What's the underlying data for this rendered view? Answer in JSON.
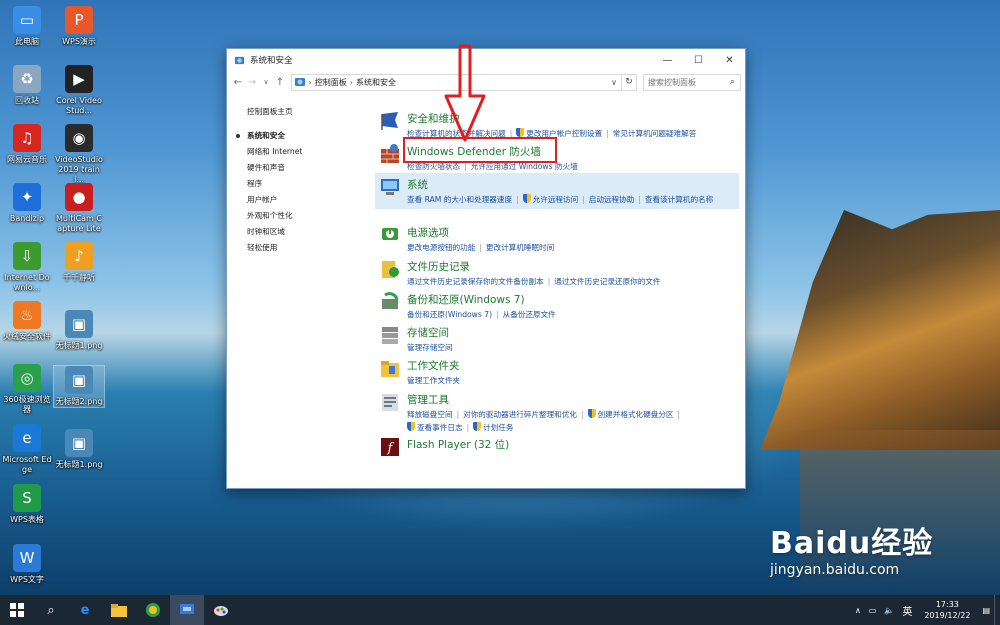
{
  "desktop": {
    "icons": [
      {
        "label": "此电脑",
        "icon": "this-pc-icon",
        "color": "#3a8ee6"
      },
      {
        "label": "WPS演示",
        "icon": "wps-presentation-icon",
        "color": "#e8572a"
      },
      {
        "label": "回收站",
        "icon": "recycle-bin-icon",
        "color": "#8aa6c0"
      },
      {
        "label": "Corel VideoStud...",
        "icon": "corel-videostudio-icon",
        "color": "#222222"
      },
      {
        "label": "网易云音乐",
        "icon": "netease-music-icon",
        "color": "#d8261f"
      },
      {
        "label": "VideoStudio 2019 traini...",
        "icon": "videostudio-training-icon",
        "color": "#2b2b2b"
      },
      {
        "label": "Bandizip",
        "icon": "bandizip-icon",
        "color": "#1e6fd9"
      },
      {
        "label": "MultiCam Capture Lite",
        "icon": "multicam-icon",
        "color": "#c81e1e"
      },
      {
        "label": "Internet Downlo...",
        "icon": "internet-download-icon",
        "color": "#3c9a2e"
      },
      {
        "label": "千千静听",
        "icon": "ttplayer-icon",
        "color": "#f0a020"
      },
      {
        "label": "火绒安全软件",
        "icon": "huorong-icon",
        "color": "#f07820"
      },
      {
        "label": "无标题1.png",
        "icon": "image-file-icon",
        "color": "#4a88b8"
      },
      {
        "label": "360极速浏览器",
        "icon": "360-browser-icon",
        "color": "#2aa04a"
      },
      {
        "label": "无标题2.png",
        "icon": "image-file-icon",
        "color": "#4a88b8"
      },
      {
        "label": "Microsoft Edge",
        "icon": "edge-icon",
        "color": "#1a78d6"
      },
      {
        "label": "无标题1.png",
        "icon": "image-file-icon",
        "color": "#4a88b8"
      },
      {
        "label": "WPS表格",
        "icon": "wps-spreadsheet-icon",
        "color": "#1f9a48"
      },
      {
        "label": "WPS文字",
        "icon": "wps-writer-icon",
        "color": "#2b7ad8"
      }
    ]
  },
  "window": {
    "title": "系统和安全",
    "controls": {
      "minimize": "—",
      "maximize": "☐",
      "close": "✕"
    },
    "address": {
      "root": "控制面板",
      "current": "系统和安全"
    },
    "search_placeholder": "搜索控制面板",
    "leftnav": {
      "home": "控制面板主页",
      "items": [
        "系统和安全",
        "网络和 Internet",
        "硬件和声音",
        "程序",
        "用户帐户",
        "外观和个性化",
        "时钟和区域",
        "轻松使用"
      ]
    },
    "categories": [
      {
        "title": "安全和维护",
        "icon": "security-maintenance-icon",
        "links": [
          [
            "检查计算机的状态并解决问题",
            false
          ],
          [
            "更改用户帐户控制设置",
            true
          ],
          [
            "常见计算机问题疑难解答",
            false
          ]
        ]
      },
      {
        "title": "Windows Defender 防火墙",
        "icon": "firewall-icon",
        "links": [
          [
            "检查防火墙状态",
            false
          ],
          [
            "允许应用通过 Windows 防火墙",
            false
          ]
        ]
      },
      {
        "title": "系统",
        "icon": "system-icon",
        "links": [
          [
            "查看 RAM 的大小和处理器速度",
            false
          ],
          [
            "允许远程访问",
            true
          ],
          [
            "启动远程协助",
            false
          ],
          [
            "查看该计算机的名称",
            false
          ]
        ]
      },
      {
        "title": "电源选项",
        "icon": "power-options-icon",
        "links": [
          [
            "更改电源按钮的功能",
            false
          ],
          [
            "更改计算机睡眠时间",
            false
          ]
        ]
      },
      {
        "title": "文件历史记录",
        "icon": "file-history-icon",
        "links": [
          [
            "通过文件历史记录保存你的文件备份副本",
            false
          ],
          [
            "通过文件历史记录还原你的文件",
            false
          ]
        ]
      },
      {
        "title": "备份和还原(Windows 7)",
        "icon": "backup-restore-icon",
        "links": [
          [
            "备份和还原(Windows 7)",
            false
          ],
          [
            "从备份还原文件",
            false
          ]
        ]
      },
      {
        "title": "存储空间",
        "icon": "storage-spaces-icon",
        "links": [
          [
            "管理存储空间",
            false
          ]
        ]
      },
      {
        "title": "工作文件夹",
        "icon": "work-folders-icon",
        "links": [
          [
            "管理工作文件夹",
            false
          ]
        ]
      },
      {
        "title": "管理工具",
        "icon": "admin-tools-icon",
        "links": [
          [
            "释放磁盘空间",
            false
          ],
          [
            "对你的驱动器进行碎片整理和优化",
            false
          ],
          [
            "创建并格式化硬盘分区",
            true
          ],
          [
            "查看事件日志",
            true
          ],
          [
            "计划任务",
            true
          ]
        ]
      },
      {
        "title": "Flash Player (32 位)",
        "icon": "flash-player-icon",
        "links": []
      }
    ]
  },
  "taskbar": {
    "clock_time": "17:33",
    "clock_date": "2019/12/22",
    "ime": "英"
  },
  "watermark": {
    "brand": "Baidu经验",
    "url": "jingyan.baidu.com"
  }
}
